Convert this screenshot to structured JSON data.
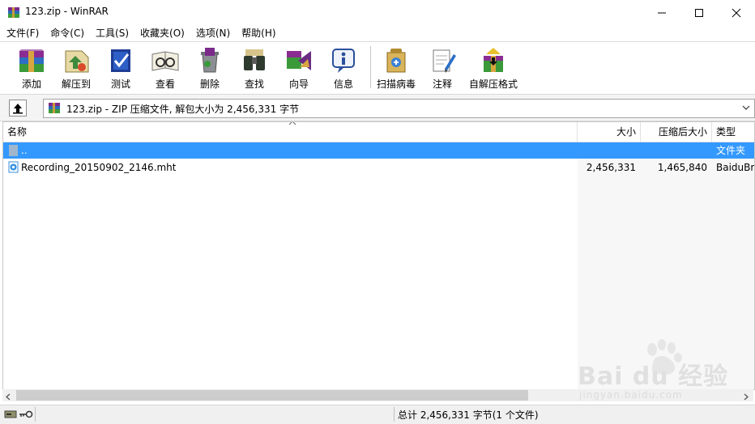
{
  "window": {
    "title": "123.zip - WinRAR",
    "controls": {
      "minimize": "—",
      "maximize": "☐",
      "close": "✕"
    }
  },
  "menu": [
    "文件(F)",
    "命令(C)",
    "工具(S)",
    "收藏夹(O)",
    "选项(N)",
    "帮助(H)"
  ],
  "toolbar": {
    "buttons": [
      {
        "label": "添加",
        "icon": "add-archive-icon"
      },
      {
        "label": "解压到",
        "icon": "extract-to-icon"
      },
      {
        "label": "测试",
        "icon": "test-icon"
      },
      {
        "label": "查看",
        "icon": "view-icon"
      },
      {
        "label": "删除",
        "icon": "delete-icon"
      },
      {
        "label": "查找",
        "icon": "find-icon"
      },
      {
        "label": "向导",
        "icon": "wizard-icon"
      },
      {
        "label": "信息",
        "icon": "info-icon"
      },
      {
        "label": "扫描病毒",
        "icon": "scan-virus-icon"
      },
      {
        "label": "注释",
        "icon": "comment-icon"
      },
      {
        "label": "自解压格式",
        "icon": "sfx-icon"
      }
    ]
  },
  "address": {
    "path": "123.zip - ZIP 压缩文件, 解包大小为 2,456,331 字节"
  },
  "list": {
    "columns": {
      "name": "名称",
      "size": "大小",
      "packed": "压缩后大小",
      "type": "类型"
    },
    "rows": [
      {
        "name": "..",
        "size": "",
        "packed": "",
        "type": "文件夹",
        "selected": true
      },
      {
        "name": "Recording_20150902_2146.mht",
        "size": "2,456,331",
        "packed": "1,465,840",
        "type": "BaiduBr",
        "selected": false
      }
    ]
  },
  "status": {
    "text": "总计 2,456,331 字节(1 个文件)"
  },
  "watermark": {
    "brand": "Bai du 经验",
    "url": "jingyan.baidu.com"
  },
  "colors": {
    "selection": "#3399ff",
    "column_shade": "#f7f7f7"
  }
}
